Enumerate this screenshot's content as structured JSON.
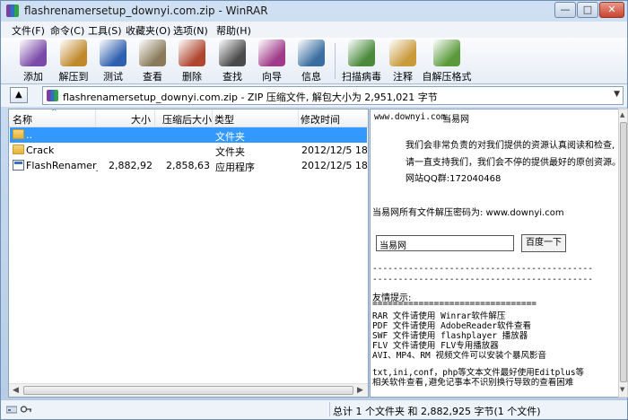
{
  "window": {
    "title": "flashrenamersetup_downyi.com.zip - WinRAR",
    "minimize": "—",
    "maximize": "□",
    "close": "✕"
  },
  "menu": [
    "文件(F)",
    "命令(C)",
    "工具(S)",
    "收藏夹(O)",
    "选项(N)",
    "帮助(H)"
  ],
  "toolbar": [
    {
      "label": "添加",
      "icon": "add-icon",
      "color": "#7a4aa8"
    },
    {
      "label": "解压到",
      "icon": "extract-to-icon",
      "color": "#c08a2c"
    },
    {
      "label": "测试",
      "icon": "test-icon",
      "color": "#2f5fb0"
    },
    {
      "label": "查看",
      "icon": "view-icon",
      "color": "#8a7a5a"
    },
    {
      "label": "删除",
      "icon": "delete-icon",
      "color": "#b0462f"
    },
    {
      "label": "查找",
      "icon": "find-icon",
      "color": "#4a4a4a"
    },
    {
      "label": "向导",
      "icon": "wizard-icon",
      "color": "#a03a8a"
    },
    {
      "label": "信息",
      "icon": "info-icon",
      "color": "#3a6ea0"
    },
    {
      "label": "扫描病毒",
      "icon": "virus-scan-icon",
      "color": "#4a8a3a"
    },
    {
      "label": "注释",
      "icon": "comment-icon",
      "color": "#c89a3a"
    },
    {
      "label": "自解压格式",
      "icon": "sfx-icon",
      "color": "#5a9a3a"
    }
  ],
  "address": {
    "text": "flashrenamersetup_downyi.com.zip - ZIP 压缩文件, 解包大小为 2,951,021 字节"
  },
  "columns": {
    "name": "名称",
    "size": "大小",
    "packed": "压缩后大小",
    "type": "类型",
    "modified": "修改时间"
  },
  "files": [
    {
      "name": "..",
      "size": "",
      "packed": "",
      "type": "文件夹",
      "modified": "",
      "icon": "folder-icon",
      "selected": true
    },
    {
      "name": "Crack",
      "size": "",
      "packed": "",
      "type": "文件夹",
      "modified": "2012/12/5 18...",
      "icon": "folder-icon",
      "selected": false
    },
    {
      "name": "FlashRenamer_...",
      "size": "2,882,925",
      "packed": "2,858,636",
      "type": "应用程序",
      "modified": "2012/12/5 18...",
      "icon": "exe-icon",
      "selected": false
    }
  ],
  "comment": {
    "site": "www.downyi.com",
    "site_name": "当易网",
    "line1": "我们会非常负责的对我们提供的资源认真阅读和检查,",
    "line2": "请一直支持我们，我们会不停的提供最好的原创资源。",
    "qq": "网站QQ群:172040468",
    "password": "当易网所有文件解压密码为: www.downyi.com",
    "search_value": "当易网",
    "search_button": "百度一下",
    "dashes1": "-------------------------------------------",
    "dashes2": "-------------------------------------------",
    "tips_title": "友情提示:",
    "equals": "================================",
    "tips": [
      "RAR 文件请使用 Winrar软件解压",
      "PDF 文件请使用 AdobeReader软件查看",
      "SWF 文件请使用 flashplayer 播放器",
      "FLV 文件请使用 FLV专用播放器",
      "AVI、MP4、RM 视频文件可以安装个暴风影音"
    ],
    "note1": "txt,ini,conf，php等文本文件最好使用Editplus等",
    "note2": "相关软件查看,避免记事本不识别换行导致的查看困难"
  },
  "status": {
    "text": "总计 1 个文件夹 和 2,882,925 字节(1 个文件)"
  }
}
